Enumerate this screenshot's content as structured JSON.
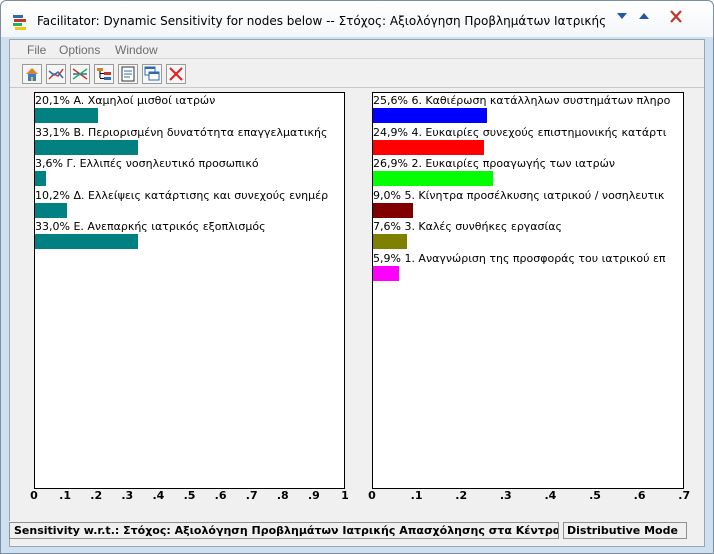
{
  "window": {
    "title": "Facilitator: Dynamic Sensitivity for nodes below -- Στόχος: Αξιολόγηση Προβλημάτων Ιατρικής Απασχό..."
  },
  "menu": [
    "File",
    "Options",
    "Window"
  ],
  "toolbar": [
    "home-icon",
    "line-sensitivity-icon",
    "gradient-icon",
    "tree-icon",
    "report-icon",
    "windows-icon",
    "close-icon"
  ],
  "colors": {
    "teal": "#008080",
    "blue": "#0000ff",
    "red": "#ff0000",
    "green": "#00ff00",
    "maroon": "#800000",
    "olive": "#808000",
    "magenta": "#ff00ff"
  },
  "chart_data": [
    {
      "type": "bar",
      "orientation": "horizontal",
      "title": "",
      "xlim": [
        0,
        1
      ],
      "xticks": [
        "0",
        ".1",
        ".2",
        ".3",
        ".4",
        ".5",
        ".6",
        ".7",
        ".8",
        ".9",
        "1"
      ],
      "categories": [
        "20,1% A. Χαμηλοί μισθοί ιατρών",
        "33,1% B. Περιορισμένη δυνατότητα επαγγελματικής",
        "3,6% Γ. Ελλιπές νοσηλευτικό προσωπικό",
        "10,2% Δ. Ελλείψεις κατάρτισης και συνεχούς ενημέρ",
        "33,0% Ε. Ανεπαρκής ιατρικός εξοπλισμός"
      ],
      "values": [
        0.201,
        0.331,
        0.036,
        0.102,
        0.33
      ],
      "colors": [
        "#008080",
        "#008080",
        "#008080",
        "#008080",
        "#008080"
      ]
    },
    {
      "type": "bar",
      "orientation": "horizontal",
      "title": "",
      "xlim": [
        0,
        0.7
      ],
      "xticks": [
        "0",
        ".1",
        ".2",
        ".3",
        ".4",
        ".5",
        ".6",
        ".7"
      ],
      "categories": [
        "25,6% 6. Καθιέρωση κατάλληλων συστημάτων πληρο",
        "24,9% 4. Ευκαιρίες συνεχούς επιστημονικής κατάρτι",
        "26,9% 2. Ευκαιρίες προαγωγής των ιατρών",
        "9,0% 5. Κίνητρα προσέλκυσης ιατρικού / νοσηλευτικ",
        "7,6% 3. Καλές συνθήκες εργασίας",
        "5,9% 1. Αναγνώριση της προσφοράς του ιατρικού επ"
      ],
      "values": [
        0.256,
        0.249,
        0.269,
        0.09,
        0.076,
        0.059
      ],
      "colors": [
        "#0000ff",
        "#ff0000",
        "#00ff00",
        "#800000",
        "#808000",
        "#ff00ff"
      ]
    }
  ],
  "status": {
    "left": "Sensitivity w.r.t.: Στόχος: Αξιολόγηση Προβλημάτων Ιατρικής Απασχόλησης στα Κέντρα Υγεί",
    "right": "Distributive Mode"
  }
}
